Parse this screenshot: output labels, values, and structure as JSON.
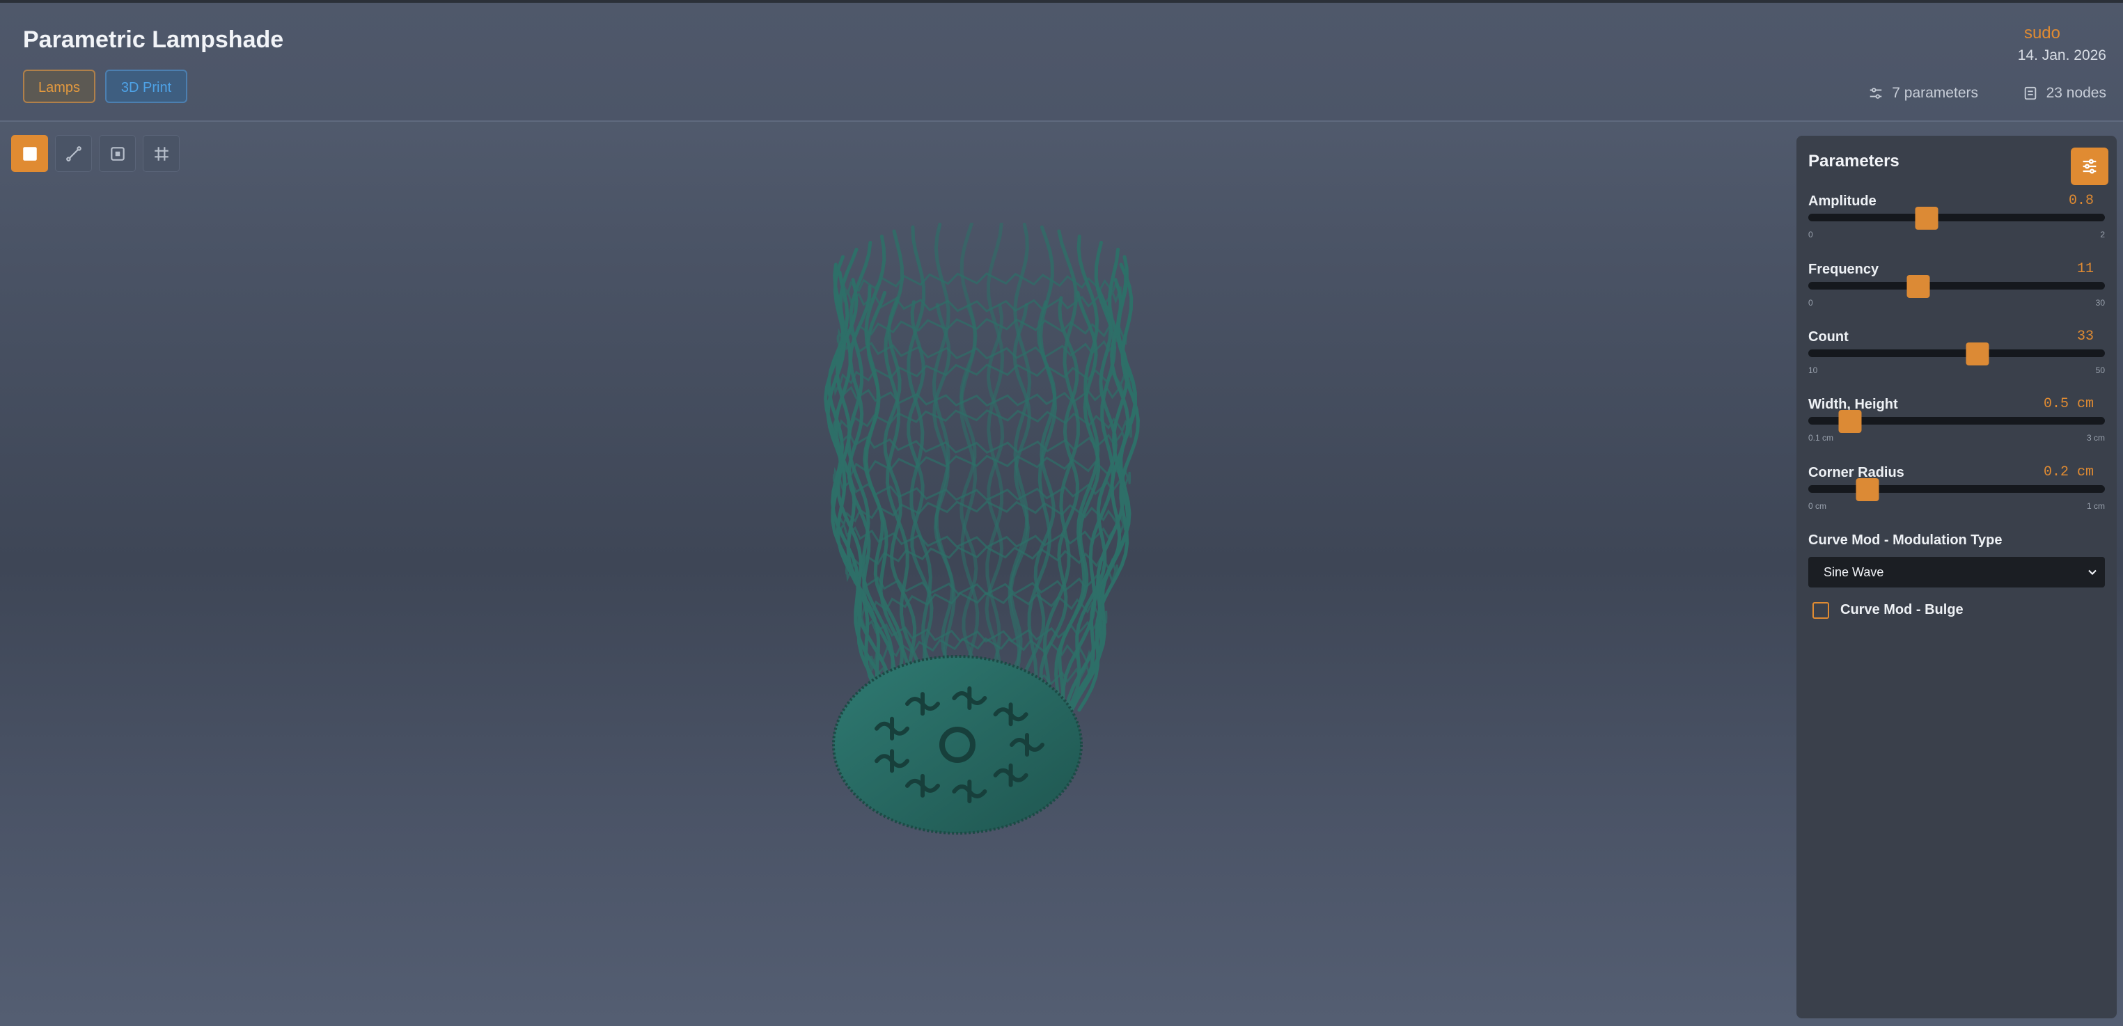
{
  "header": {
    "title": "Parametric Lampshade",
    "tags": [
      "Lamps",
      "3D Print"
    ],
    "user": "sudo",
    "date": "14. Jan. 2026",
    "parameters_count": "7 parameters",
    "nodes_count": "23 nodes"
  },
  "toolbar": {
    "tools": [
      "solid-view-icon",
      "wireframe-view-icon",
      "points-view-icon",
      "grid-toggle-icon"
    ],
    "active": "solid-view-icon"
  },
  "viewport": {
    "model_color": "#2e6f68",
    "icon": "lampshade-3d-model"
  },
  "panel": {
    "title": "Parameters",
    "toggle_icon": "sliders-icon",
    "params": [
      {
        "label": "Amplitude",
        "value": "0.8",
        "min": "0",
        "max": "2",
        "fraction": 0.4
      },
      {
        "label": "Frequency",
        "value": "11",
        "min": "0",
        "max": "30",
        "fraction": 0.37
      },
      {
        "label": "Count",
        "value": "33",
        "min": "10",
        "max": "50",
        "fraction": 0.57
      },
      {
        "label": "Width, Height",
        "value": "0.5 cm",
        "min": "0.1 cm",
        "max": "3 cm",
        "fraction": 0.14
      },
      {
        "label": "Corner Radius",
        "value": "0.2 cm",
        "min": "0 cm",
        "max": "1 cm",
        "fraction": 0.2
      }
    ],
    "modulation_label": "Curve Mod - Modulation Type",
    "modulation_value": "Sine Wave",
    "bulge_label": "Curve Mod - Bulge",
    "bulge_checked": false
  },
  "colors": {
    "accent": "#e08b32",
    "print_tag": "#4ea2e6"
  }
}
